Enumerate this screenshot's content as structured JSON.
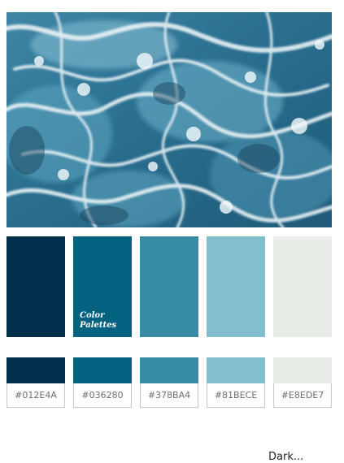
{
  "image": {
    "alt_icon": "ocean-foam-photo-icon",
    "colors": {
      "deep": "#012E4A",
      "mid": "#036280",
      "light": "#378BA4",
      "foam": "#E8EDE7"
    }
  },
  "brand": {
    "text": "Color\nPalettes"
  },
  "swatches": [
    {
      "hex": "#012E4A",
      "label": "#012E4A"
    },
    {
      "hex": "#036280",
      "label": "#036280"
    },
    {
      "hex": "#378BA4",
      "label": "#378BA4"
    },
    {
      "hex": "#81BECE",
      "label": "#81BECE"
    },
    {
      "hex": "#E8EDE7",
      "label": "#E8EDE7"
    }
  ],
  "footer": {
    "text": "Dark..."
  }
}
